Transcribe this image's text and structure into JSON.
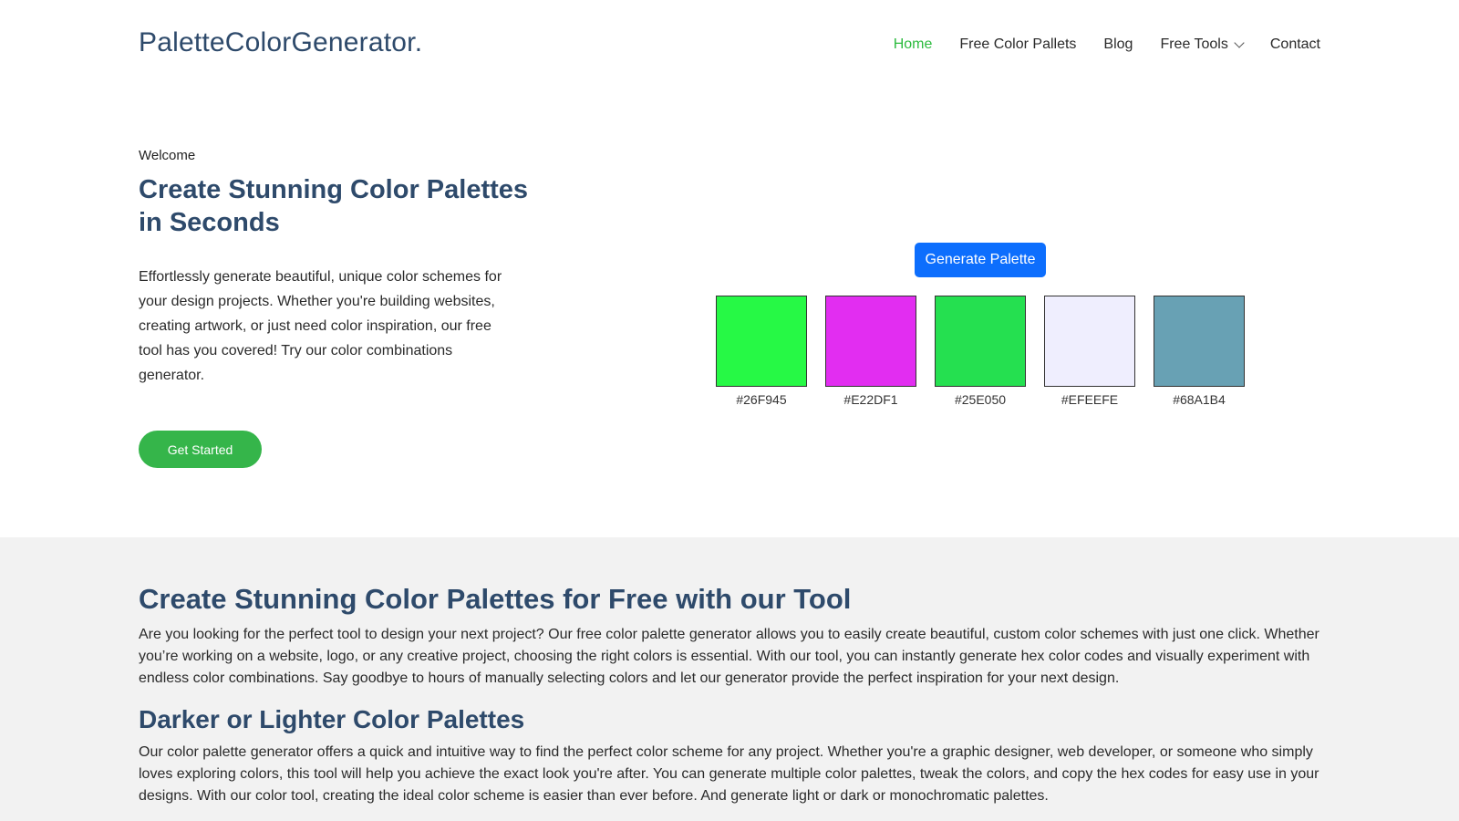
{
  "header": {
    "logo": "PaletteColorGenerator.",
    "nav": [
      {
        "label": "Home",
        "active": true
      },
      {
        "label": "Free Color Pallets"
      },
      {
        "label": "Blog"
      },
      {
        "label": "Free Tools",
        "dropdown": true
      },
      {
        "label": "Contact"
      }
    ]
  },
  "hero": {
    "eyebrow": "Welcome",
    "title": "Create Stunning Color Palettes in Seconds",
    "text": "Effortlessly generate beautiful, unique color schemes for your design projects. Whether you're building websites, creating artwork, or just need color inspiration, our free tool has you covered! Try our color combinations generator.",
    "cta_label": "Get Started"
  },
  "generator": {
    "button_label": "Generate Palette",
    "swatches": [
      {
        "hex": "#26F945"
      },
      {
        "hex": "#E22DF1"
      },
      {
        "hex": "#25E050"
      },
      {
        "hex": "#EFEEFE"
      },
      {
        "hex": "#68A1B4"
      }
    ]
  },
  "info": {
    "heading1": "Create Stunning Color Palettes for Free with our Tool",
    "para1": "Are you looking for the perfect tool to design your next project? Our free color palette generator allows you to easily create beautiful, custom color schemes with just one click. Whether you’re working on a website, logo, or any creative project, choosing the right colors is essential. With our tool, you can instantly generate hex color codes and visually experiment with endless color combinations. Say goodbye to hours of manually selecting colors and let our generator provide the perfect inspiration for your next design.",
    "heading2": "Darker or Lighter Color Palettes",
    "para2": "Our color palette generator offers a quick and intuitive way to find the perfect color scheme for any project. Whether you're a graphic designer, web developer, or someone who simply loves exploring colors, this tool will help you achieve the exact look you're after. You can generate multiple color palettes, tweak the colors, and copy the hex codes for easy use in your designs. With our color tool, creating the ideal color scheme is easier than ever before. And generate light or dark or monochromatic palettes."
  },
  "colors": {
    "accent_green": "#35b54a",
    "nav_active": "#2dbb3f",
    "primary_blue": "#0d6efd",
    "heading_navy": "#2e4a6b"
  },
  "icons": {
    "free_tools_dropdown": "chevron-down-icon"
  }
}
